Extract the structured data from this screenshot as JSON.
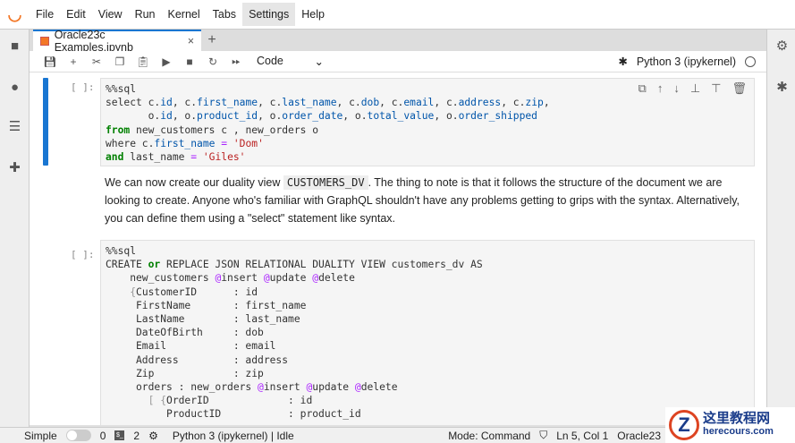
{
  "menu": [
    "File",
    "Edit",
    "View",
    "Run",
    "Kernel",
    "Tabs",
    "Settings",
    "Help"
  ],
  "tab": {
    "title": "Oracle23c Examples.ipynb",
    "close": "×",
    "add": "+"
  },
  "toolbar": {
    "cell_type": "Code",
    "chevron": "⌄",
    "kernel": "Python 3 (ipykernel)"
  },
  "cells": [
    {
      "prompt": "[ ]:",
      "lines": [
        [
          [
            "%%sql",
            ""
          ]
        ],
        [
          [
            "select c.",
            ""
          ],
          [
            "id",
            "a"
          ],
          [
            ", c.",
            ""
          ],
          [
            "first_name",
            "a"
          ],
          [
            ", c.",
            ""
          ],
          [
            "last_name",
            "a"
          ],
          [
            ", c.",
            ""
          ],
          [
            "dob",
            "a"
          ],
          [
            ", c.",
            ""
          ],
          [
            "email",
            "a"
          ],
          [
            ", c.",
            ""
          ],
          [
            "address",
            "a"
          ],
          [
            ", c.",
            ""
          ],
          [
            "zip",
            "a"
          ],
          [
            ",",
            ""
          ]
        ],
        [
          [
            "       o.",
            ""
          ],
          [
            "id",
            "a"
          ],
          [
            ", o.",
            ""
          ],
          [
            "product_id",
            "a"
          ],
          [
            ", o.",
            ""
          ],
          [
            "order_date",
            "a"
          ],
          [
            ", o.",
            ""
          ],
          [
            "total_value",
            "a"
          ],
          [
            ", o.",
            ""
          ],
          [
            "order_shipped",
            "a"
          ]
        ],
        [
          [
            "from",
            "k"
          ],
          [
            " new_customers c , new_orders o",
            ""
          ]
        ],
        [
          [
            "where c.",
            ""
          ],
          [
            "first_name",
            "a"
          ],
          [
            " ",
            ""
          ],
          [
            "=",
            "o"
          ],
          [
            " ",
            ""
          ],
          [
            "'Dom'",
            "s"
          ]
        ],
        [
          [
            "and",
            "k"
          ],
          [
            " last_name ",
            ""
          ],
          [
            "=",
            "o"
          ],
          [
            " ",
            ""
          ],
          [
            "'Giles'",
            "s"
          ]
        ]
      ]
    },
    {
      "prompt": "[ ]:",
      "lines": [
        [
          [
            "%%sql",
            ""
          ]
        ],
        [
          [
            "CREATE ",
            ""
          ],
          [
            "or",
            "k"
          ],
          [
            " REPLACE JSON RELATIONAL DUALITY VIEW customers_dv AS",
            ""
          ]
        ],
        [
          [
            "    new_customers ",
            ""
          ],
          [
            "@",
            "o"
          ],
          [
            "insert ",
            ""
          ],
          [
            "@",
            "o"
          ],
          [
            "update ",
            ""
          ],
          [
            "@",
            "o"
          ],
          [
            "delete",
            ""
          ]
        ],
        [
          [
            "    ",
            ""
          ],
          [
            "{",
            "p"
          ],
          [
            "CustomerID      : id",
            ""
          ]
        ],
        [
          [
            "     FirstName       : first_name",
            ""
          ]
        ],
        [
          [
            "     LastName        : last_name",
            ""
          ]
        ],
        [
          [
            "     DateOfBirth     : dob",
            ""
          ]
        ],
        [
          [
            "     Email           : email",
            ""
          ]
        ],
        [
          [
            "     Address         : address",
            ""
          ]
        ],
        [
          [
            "     Zip             : zip",
            ""
          ]
        ],
        [
          [
            "     orders : new_orders ",
            ""
          ],
          [
            "@",
            "o"
          ],
          [
            "insert ",
            ""
          ],
          [
            "@",
            "o"
          ],
          [
            "update ",
            ""
          ],
          [
            "@",
            "o"
          ],
          [
            "delete",
            ""
          ]
        ],
        [
          [
            "       ",
            ""
          ],
          [
            "[ {",
            "p"
          ],
          [
            "OrderID             : id",
            ""
          ]
        ],
        [
          [
            "          ProductID           : product_id",
            ""
          ]
        ]
      ]
    }
  ],
  "markdown": {
    "before": "We can now create our duality view ",
    "code": "CUSTOMERS_DV",
    "after": ". The thing to note is that it follows the structure of the document we are looking to create. Anyone who's familiar with GraphQL shouldn't have any problems getting to grips with the syntax. Alternatively, you can define them using a \"select\" statement like syntax."
  },
  "status": {
    "mode_label": "Simple",
    "terminals": "0",
    "kernels": "2",
    "kernel_status": "Python 3 (ipykernel) | Idle",
    "mode": "Mode: Command",
    "position": "Ln 5, Col 1",
    "file": "Oracle23"
  },
  "watermark": {
    "line1": "这里教程网",
    "line2": "herecours.com"
  }
}
